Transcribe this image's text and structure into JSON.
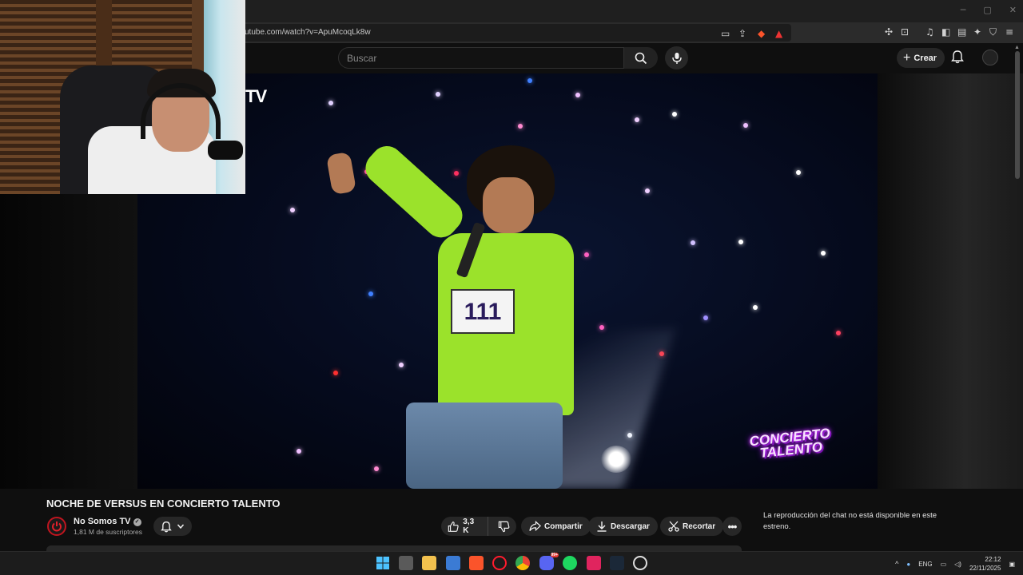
{
  "browser": {
    "url": "utube.com/watch?v=ApuMcoqLk8w"
  },
  "header": {
    "search_placeholder": "Buscar",
    "create_label": "Crear"
  },
  "video": {
    "watermark": "TV",
    "overlay_logo": "CONCIERTO TALENTO",
    "bib_number": "111"
  },
  "below_video": {
    "title": "NOCHE DE VERSUS EN CONCIERTO TALENTO",
    "channel_name": "No Somos TV",
    "subscribers": "1,81 M de suscriptores",
    "like_count": "3,3 K",
    "share_label": "Compartir",
    "download_label": "Descargar",
    "clip_label": "Recortar"
  },
  "chat": {
    "message": "La reproducción del chat no está disponible en este estreno."
  },
  "taskbar": {
    "language": "ENG",
    "time": "22:12",
    "date": "22/11/2025",
    "discord_badge": "99+"
  },
  "colors": {
    "background": "#0f0f0f",
    "pill": "#272727",
    "channel_red": "#c0151f",
    "shirt_green": "#9be22b"
  }
}
